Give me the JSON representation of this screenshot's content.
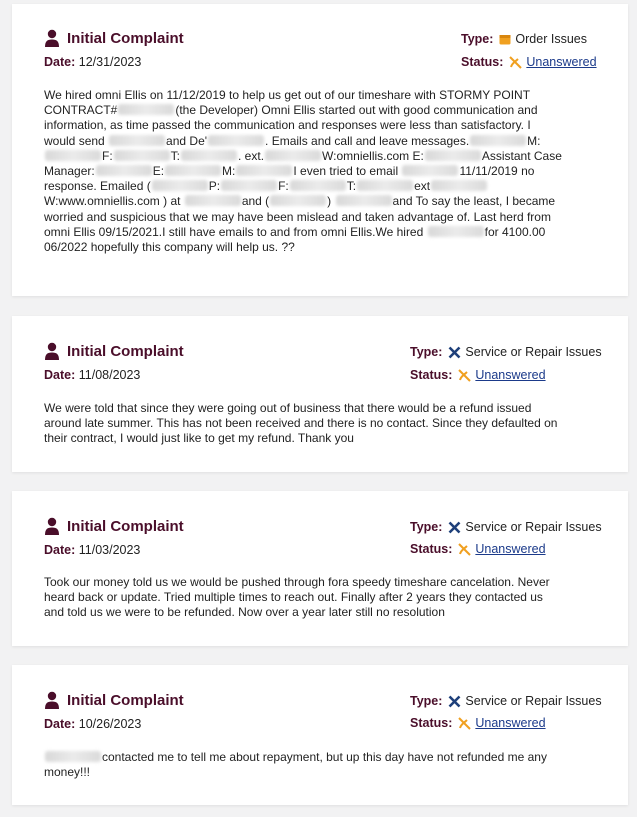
{
  "title_label": "Initial Complaint",
  "date_label": "Date:",
  "type_label": "Type:",
  "status_label": "Status:",
  "redacted_text": "REMOVED",
  "colors": {
    "title": "#4a0e2a",
    "link": "#1b3a8a",
    "icon_orange": "#f0a020",
    "icon_blue": "#1e3f7a"
  },
  "complaints": [
    {
      "date": "12/31/2023",
      "type": "Order Issues",
      "type_icon": "box-icon",
      "status": "Unanswered",
      "status_icon": "unanswered-icon",
      "body_segments": [
        "We hired omni Ellis on 11/12/2019 to help us get out of our timeshare with STORMY POINT CONTRACT#",
        "(the Developer) Omni Ellis started out with good communication and information, as time passed the communication and responses were less than satisfactory. I would send ",
        "and De'",
        ". Emails and call and leave messages.",
        "M:",
        "F:",
        "T:",
        ". ext.",
        "W:omniellis.com E:",
        "Assistant Case Manager:",
        "E:",
        "M:",
        "I even tried to email ",
        "11/11/2019 no response. Emailed (",
        "P:",
        "F:",
        "T:",
        "ext",
        "W:www.omniellis.com ) at ",
        "and (",
        ") ",
        "and To say the least, I became worried and suspicious that we may have been mislead and taken advantage of. Last herd from omni Ellis 09/15/2021.I still have emails to and from omni Ellis.We hired ",
        "for 4100.00 06/2022 hopefully this company will help us. ??"
      ]
    },
    {
      "date": "11/08/2023",
      "type": "Service or Repair Issues",
      "type_icon": "tools-icon",
      "status": "Unanswered",
      "status_icon": "unanswered-icon",
      "body": "We were told that since they were going out of business that there would be a refund issued around late summer. This has not been received and there is no contact. Since they defaulted on their contract, I would just like to get my refund. Thank you"
    },
    {
      "date": "11/03/2023",
      "type": "Service or Repair Issues",
      "type_icon": "tools-icon",
      "status": "Unanswered",
      "status_icon": "unanswered-icon",
      "body": "Took our money told us we would be pushed through fora speedy timeshare cancelation. Never heard back or update. Tried multiple times to reach out. Finally after 2 years they contacted us and told us we were to be refunded. Now over a year later still no resolution"
    },
    {
      "date": "10/26/2023",
      "type": "Service or Repair Issues",
      "type_icon": "tools-icon",
      "status": "Unanswered",
      "status_icon": "unanswered-icon",
      "body_segments": [
        "contacted me to tell me about repayment, but up this day have not refunded me any money!!!"
      ]
    }
  ]
}
